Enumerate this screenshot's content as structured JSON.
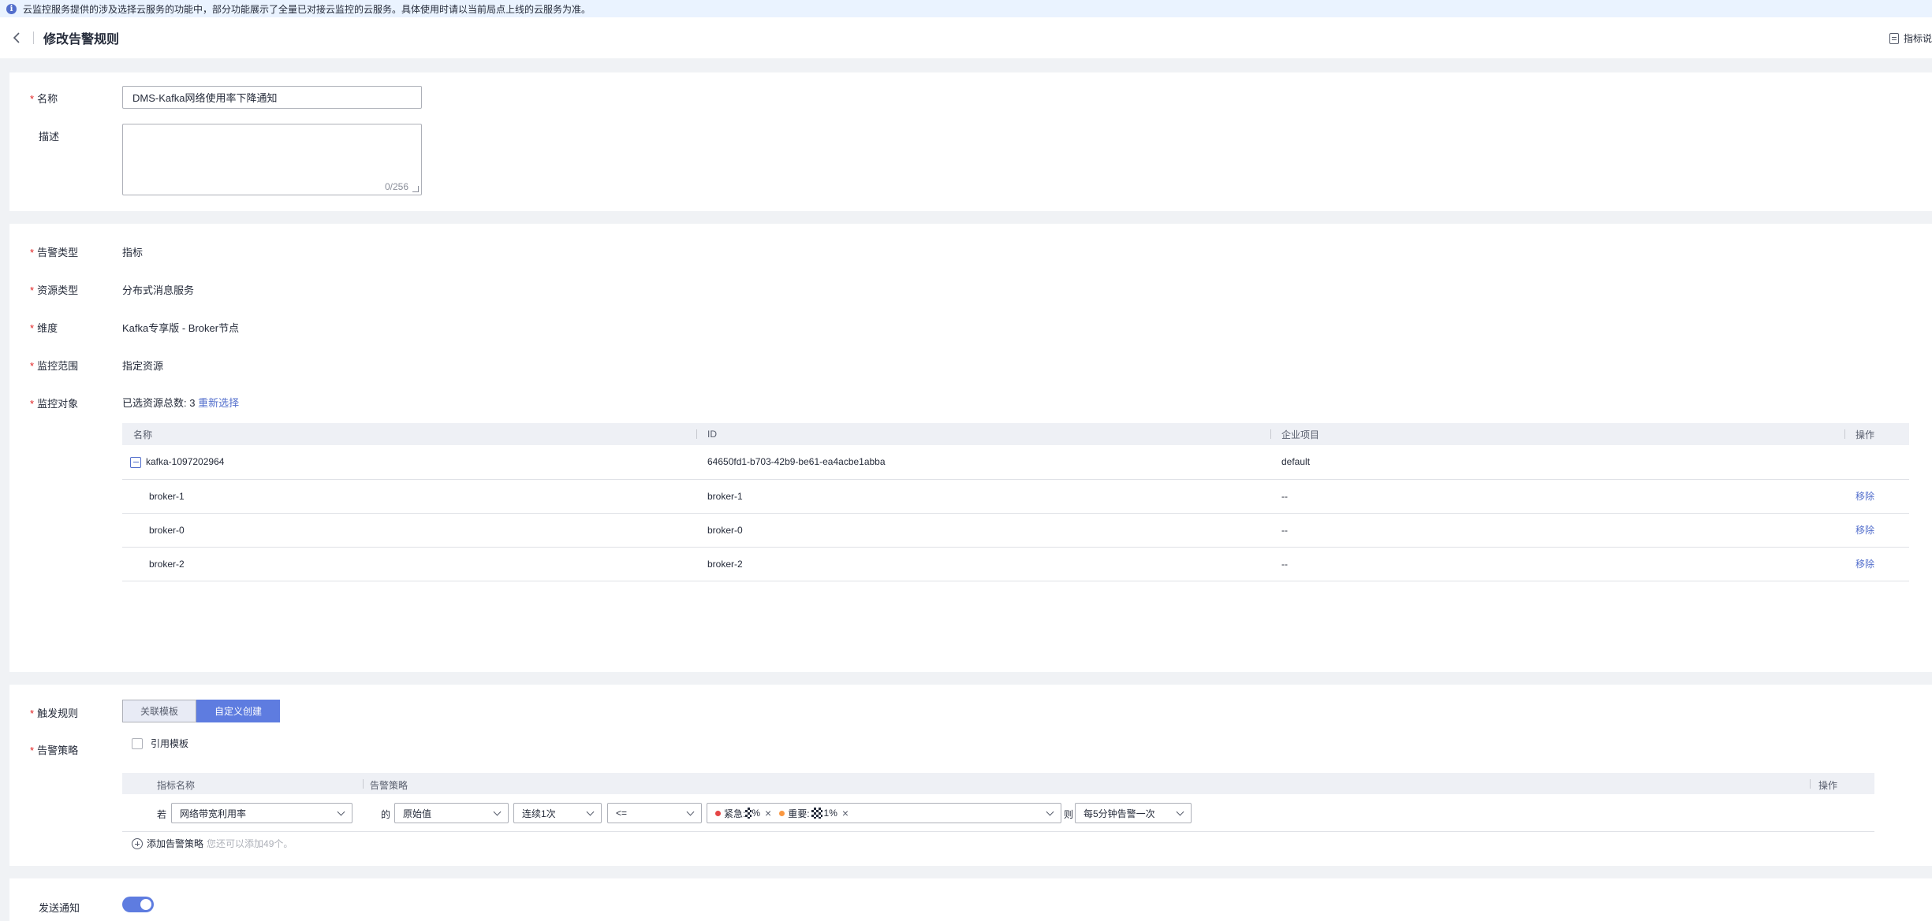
{
  "notice": {
    "text": "云监控服务提供的涉及选择云服务的功能中，部分功能展示了全量已对接云监控的云服务。具体使用时请以当前局点上线的云服务为准。"
  },
  "header": {
    "title": "修改告警规则",
    "doc_link": "指标说"
  },
  "basic": {
    "name_label": "名称",
    "name_value": "DMS-Kafka网络使用率下降通知",
    "desc_label": "描述",
    "desc_counter": "0/256"
  },
  "config": {
    "alarm_type_label": "告警类型",
    "alarm_type_value": "指标",
    "resource_type_label": "资源类型",
    "resource_type_value": "分布式消息服务",
    "dimension_label": "维度",
    "dimension_value": "Kafka专享版 - Broker节点",
    "scope_label": "监控范围",
    "scope_value": "指定资源",
    "target_label": "监控对象",
    "target_prefix": "已选资源总数: 3",
    "reselect": "重新选择",
    "table": {
      "headers": [
        "名称",
        "ID",
        "企业项目",
        "操作"
      ],
      "parent": {
        "name": "kafka-1097202964",
        "id": "64650fd1-b703-42b9-be61-ea4acbe1abba",
        "project": "default"
      },
      "rows": [
        {
          "name": "broker-1",
          "id": "broker-1",
          "project": "--",
          "action": "移除"
        },
        {
          "name": "broker-0",
          "id": "broker-0",
          "project": "--",
          "action": "移除"
        },
        {
          "name": "broker-2",
          "id": "broker-2",
          "project": "--",
          "action": "移除"
        }
      ]
    }
  },
  "trigger": {
    "label": "触发规则",
    "options": [
      "关联模板",
      "自定义创建"
    ],
    "policy_label": "告警策略",
    "use_template": "引用模板",
    "headers": {
      "metric": "指标名称",
      "policy": "告警策略",
      "action": "操作"
    },
    "row": {
      "if": "若",
      "metric": "网络带宽利用率",
      "of": "的",
      "value_type": "原始值",
      "period": "连续1次",
      "operator": "<=",
      "tag1_label": "紧急:",
      "tag1_tail": "%",
      "tag1_color": "#e54545",
      "tag2_label": "重要:",
      "tag2_tail": "1%",
      "tag2_color": "#fa9841",
      "then": "则",
      "frequency": "每5分钟告警一次"
    },
    "add_policy": "添加告警策略",
    "add_hint": "您还可以添加49个。"
  },
  "notify": {
    "label": "发送通知"
  }
}
